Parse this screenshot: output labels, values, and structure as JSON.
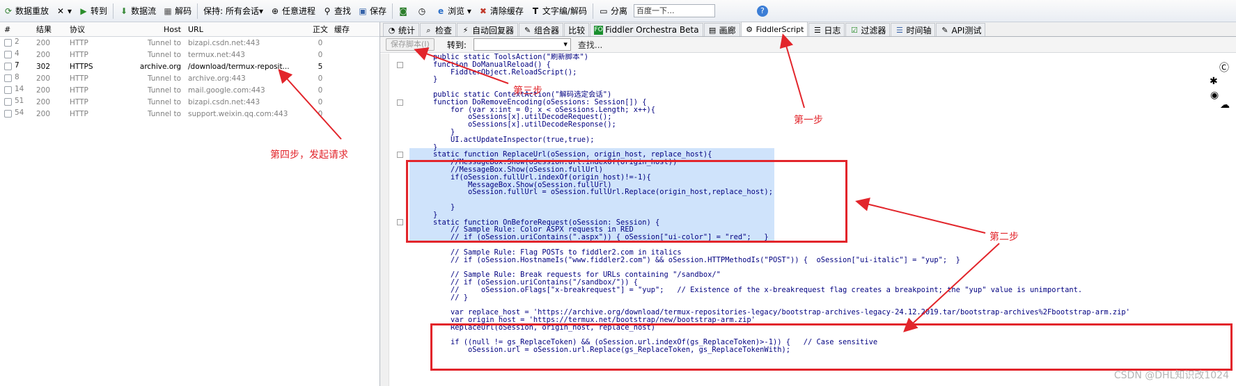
{
  "toolbar": {
    "items": [
      "数据重放",
      "转到",
      "数据流",
      "解码",
      "保持: 所有会话",
      "任意进程",
      "查找",
      "保存",
      "浏览",
      "清除缓存",
      "文字编/解码",
      "分离"
    ],
    "search_placeholder": "百度一下..."
  },
  "sessions": {
    "headers": [
      "#",
      "结果",
      "协议",
      "Host",
      "URL",
      "正文",
      "缓存"
    ],
    "rows": [
      {
        "id": "2",
        "result": "200",
        "protocol": "HTTP",
        "host": "Tunnel to",
        "url": "bizapi.csdn.net:443",
        "body": "0"
      },
      {
        "id": "4",
        "result": "200",
        "protocol": "HTTP",
        "host": "Tunnel to",
        "url": "termux.net:443",
        "body": "0"
      },
      {
        "id": "7",
        "result": "302",
        "protocol": "HTTPS",
        "host": "archive.org",
        "url": "/download/termux-reposit...",
        "body": "5"
      },
      {
        "id": "8",
        "result": "200",
        "protocol": "HTTP",
        "host": "Tunnel to",
        "url": "archive.org:443",
        "body": "0"
      },
      {
        "id": "14",
        "result": "200",
        "protocol": "HTTP",
        "host": "Tunnel to",
        "url": "mail.google.com:443",
        "body": "0"
      },
      {
        "id": "51",
        "result": "200",
        "protocol": "HTTP",
        "host": "Tunnel to",
        "url": "bizapi.csdn.net:443",
        "body": "0"
      },
      {
        "id": "54",
        "result": "200",
        "protocol": "HTTP",
        "host": "Tunnel to",
        "url": "support.weixin.qq.com:443",
        "body": "0"
      }
    ]
  },
  "tabs": [
    "统计",
    "检查",
    "自动回复器",
    "组合器",
    "比较",
    "Fiddler Orchestra Beta",
    "画廊",
    "FiddlerScript",
    "日志",
    "过滤器",
    "时间轴",
    "API测试"
  ],
  "script_bar": {
    "save_label": "保存脚本(I)",
    "goto_label": "转到:",
    "find_label": "查找..."
  },
  "code_lines": [
    "public static ToolsAction(\"刷新脚本\")",
    "function DoManualReload() {",
    "    FiddlerObject.ReloadScript();",
    "}",
    "",
    "public static ContextAction(\"解码选定会话\")",
    "function DoRemoveEncoding(oSessions: Session[]) {",
    "    for (var x:int = 0; x < oSessions.Length; x++){",
    "        oSessions[x].utilDecodeRequest();",
    "        oSessions[x].utilDecodeResponse();",
    "    }",
    "    UI.actUpdateInspector(true,true);",
    "}",
    "static function ReplaceUrl(oSession, origin_host, replace_host){",
    "    //MessageBox.Show(oSession.url.indexOf(origin_host))",
    "    //MessageBox.Show(oSession.fullUrl)",
    "    if(oSession.fullUrl.indexOf(origin_host)!=-1){",
    "        MessageBox.Show(oSession.fullUrl)",
    "        oSession.fullUrl = oSession.fullUrl.Replace(origin_host,replace_host);",
    "",
    "    }",
    "}",
    "static function OnBeforeRequest(oSession: Session) {",
    "    // Sample Rule: Color ASPX requests in RED",
    "    // if (oSession.uriContains(\".aspx\")) { oSession[\"ui-color\"] = \"red\";   }",
    "",
    "    // Sample Rule: Flag POSTs to fiddler2.com in italics",
    "    // if (oSession.HostnameIs(\"www.fiddler2.com\") && oSession.HTTPMethodIs(\"POST\")) {  oSession[\"ui-italic\"] = \"yup\";  }",
    "",
    "    // Sample Rule: Break requests for URLs containing \"/sandbox/\"",
    "    // if (oSession.uriContains(\"/sandbox/\")) {",
    "    //     oSession.oFlags[\"x-breakrequest\"] = \"yup\";   // Existence of the x-breakrequest flag creates a breakpoint; the \"yup\" value is unimportant.",
    "    // }",
    "",
    "    var replace_host = 'https://archive.org/download/termux-repositories-legacy/bootstrap-archives-legacy-24.12.2019.tar/bootstrap-archives%2Fbootstrap-arm.zip'",
    "    var origin_host = 'https://termux.net/bootstrap/new/bootstrap-arm.zip'",
    "    ReplaceUrl(oSession, origin_host, replace_host)",
    "",
    "    if ((null != gs_ReplaceToken) && (oSession.url.indexOf(gs_ReplaceToken)>-1)) {   // Case sensitive",
    "        oSession.url = oSession.url.Replace(gs_ReplaceToken, gs_ReplaceTokenWith);"
  ],
  "annotations": {
    "step1": "第一步",
    "step2": "第二步",
    "step3": "第三步",
    "step4": "第四步，发起请求"
  },
  "watermark": "CSDN @DHL知识改1024"
}
